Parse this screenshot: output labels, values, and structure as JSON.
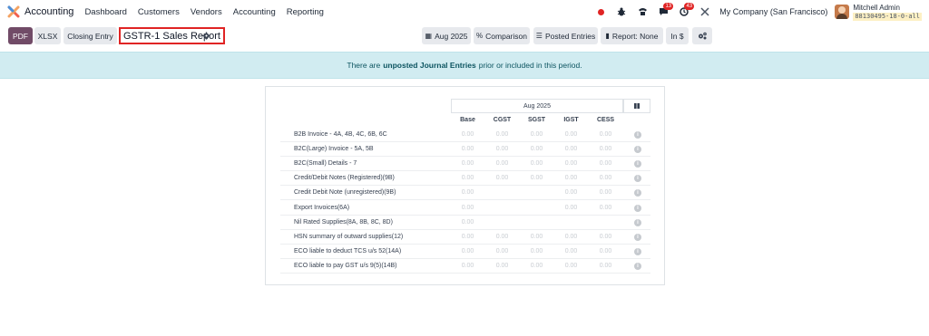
{
  "navbar": {
    "app_name": "Accounting",
    "menu": [
      "Dashboard",
      "Customers",
      "Vendors",
      "Accounting",
      "Reporting"
    ],
    "messages_badge": "13",
    "activity_badge": "43",
    "company": "My Company (San Francisco)",
    "user_name": "Mitchell Admin",
    "db_name": "88130495-18-0-all"
  },
  "toolbar": {
    "pdf": "PDF",
    "xlsx": "XLSX",
    "closing_entry": "Closing Entry",
    "report_title": "GSTR-1 Sales Report",
    "date_filter": "Aug 2025",
    "comparison": "Comparison",
    "posted_entries": "Posted Entries",
    "report_type": "Report: None",
    "currency": "In $"
  },
  "alert": {
    "prefix": "There are",
    "highlight": "unposted Journal Entries",
    "suffix": "prior or included in this period."
  },
  "report": {
    "period": "Aug 2025",
    "columns": [
      "Base",
      "CGST",
      "SGST",
      "IGST",
      "CESS"
    ],
    "rows": [
      {
        "label": "B2B Invoice - 4A, 4B, 4C, 6B, 6C",
        "values": [
          "0.00",
          "0.00",
          "0.00",
          "0.00",
          "0.00"
        ]
      },
      {
        "label": "B2C(Large) Invoice - 5A, 5B",
        "values": [
          "0.00",
          "0.00",
          "0.00",
          "0.00",
          "0.00"
        ]
      },
      {
        "label": "B2C(Small) Details - 7",
        "values": [
          "0.00",
          "0.00",
          "0.00",
          "0.00",
          "0.00"
        ]
      },
      {
        "label": "Credit/Debit Notes (Registered)(9B)",
        "values": [
          "0.00",
          "0.00",
          "0.00",
          "0.00",
          "0.00"
        ]
      },
      {
        "label": "Credit Debit Note (unregistered)(9B)",
        "values": [
          "0.00",
          "",
          "",
          "0.00",
          "0.00"
        ]
      },
      {
        "label": "Export Invoices(6A)",
        "values": [
          "0.00",
          "",
          "",
          "0.00",
          "0.00"
        ]
      },
      {
        "label": "Nil Rated Supplies(8A, 8B, 8C, 8D)",
        "values": [
          "0.00",
          "",
          "",
          "",
          ""
        ]
      },
      {
        "label": "HSN summary of outward supplies(12)",
        "values": [
          "0.00",
          "0.00",
          "0.00",
          "0.00",
          "0.00"
        ]
      },
      {
        "label": "ECO liable to deduct TCS u/s 52(14A)",
        "values": [
          "0.00",
          "0.00",
          "0.00",
          "0.00",
          "0.00"
        ]
      },
      {
        "label": "ECO liable to pay GST u/s 9(5)(14B)",
        "values": [
          "0.00",
          "0.00",
          "0.00",
          "0.00",
          "0.00"
        ]
      }
    ]
  }
}
